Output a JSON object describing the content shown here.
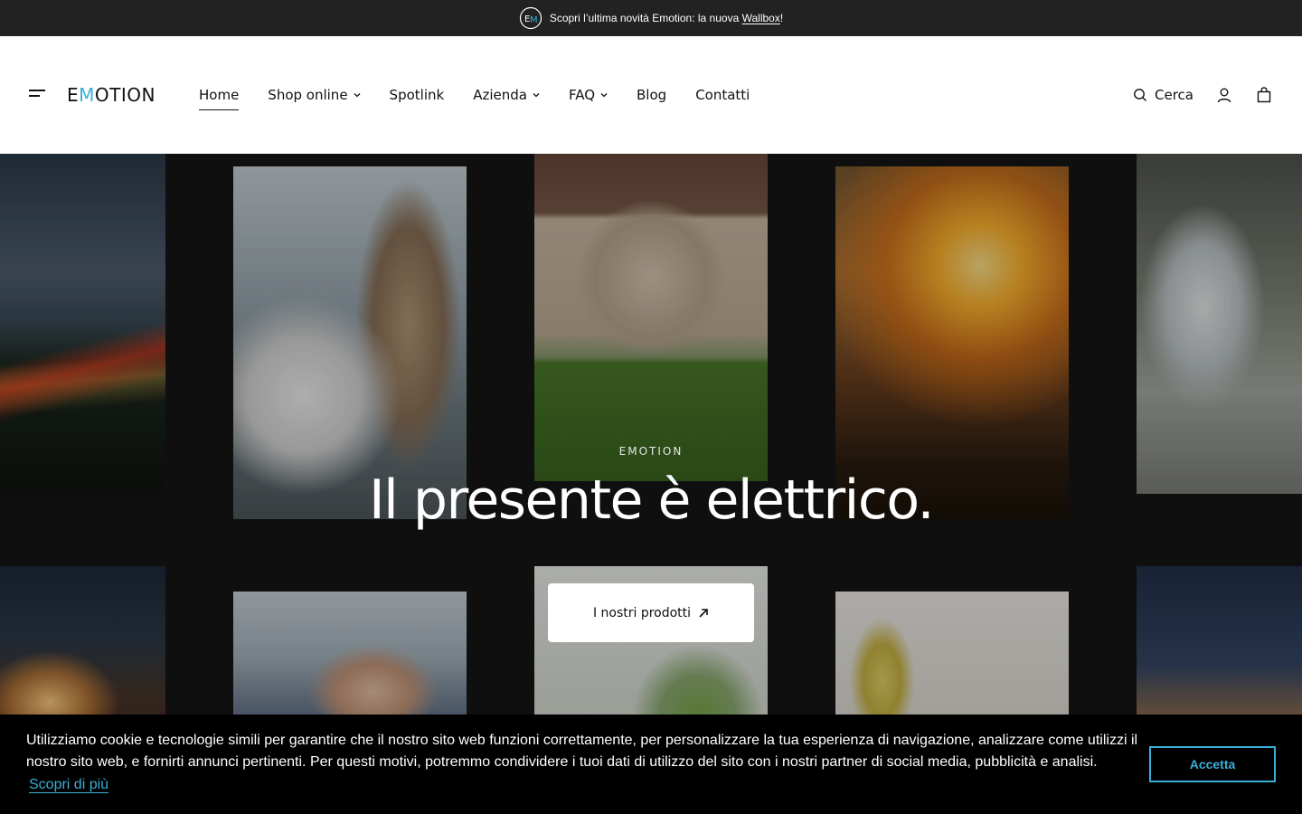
{
  "announcement": {
    "text": "Scopri l’ultima novità Emotion: la nuova ",
    "link_text": "Wallbox",
    "suffix": "!"
  },
  "header": {
    "logo": {
      "part1": "E",
      "accent": "M",
      "part2": "OTION"
    },
    "nav": [
      {
        "label": "Home",
        "active": true,
        "has_dropdown": false
      },
      {
        "label": "Shop online",
        "active": false,
        "has_dropdown": true
      },
      {
        "label": "Spotlink",
        "active": false,
        "has_dropdown": false
      },
      {
        "label": "Azienda",
        "active": false,
        "has_dropdown": true
      },
      {
        "label": "FAQ",
        "active": false,
        "has_dropdown": true
      },
      {
        "label": "Blog",
        "active": false,
        "has_dropdown": false
      },
      {
        "label": "Contatti",
        "active": false,
        "has_dropdown": false
      }
    ],
    "search_label": "Cerca",
    "icons": [
      "menu-icon",
      "search-icon",
      "account-icon",
      "cart-icon"
    ]
  },
  "hero": {
    "eyebrow": "EMOTION",
    "headline": "Il presente è elettrico.",
    "cta_label": "I nostri prodotti",
    "cta_icon": "arrow-up-right-icon"
  },
  "cookie": {
    "text": "Utilizziamo cookie e tecnologie simili per garantire che il nostro sito web funzioni correttamente, per personalizzare la tua esperienza di navigazione, analizzare come utilizzi il nostro sito web, e fornirti annunci pertinenti. Per questi motivi, potremmo condividere i tuoi dati di utilizzo del sito con i nostri partner di social media, pubblicità e analisi.",
    "learn_more": "Scopri di più",
    "accept": "Accetta"
  },
  "colors": {
    "accent": "#3aaed8",
    "announcement_bg": "#222222",
    "cookie_bg": "#000000"
  }
}
